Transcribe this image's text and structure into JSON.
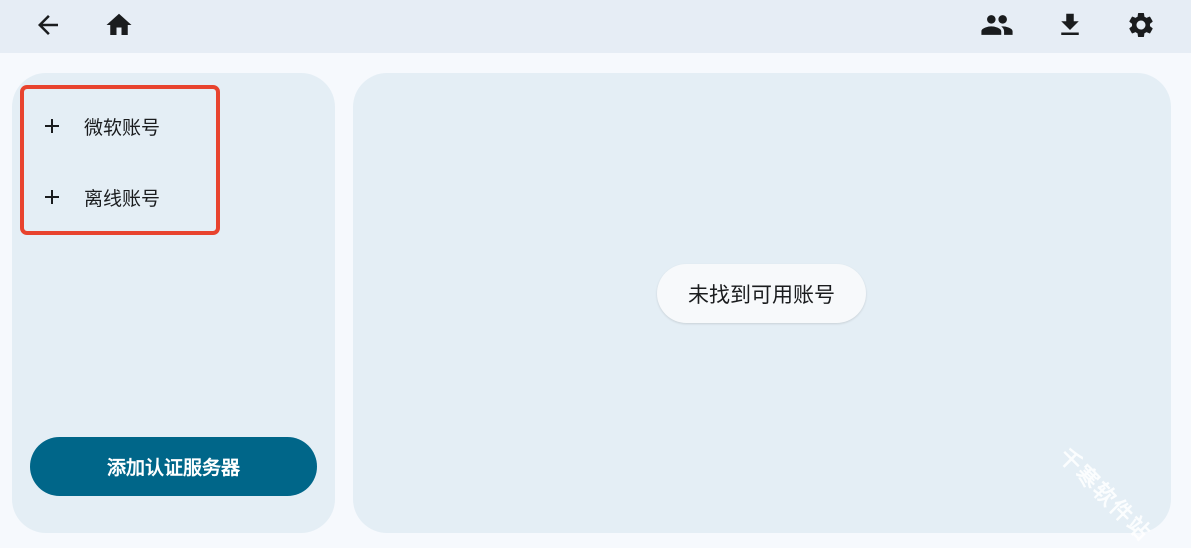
{
  "topbar": {
    "icons": {
      "back": "arrow-left-icon",
      "home": "home-icon",
      "accounts": "people-icon",
      "download": "download-icon",
      "settings": "gear-icon"
    }
  },
  "sidebar": {
    "items": [
      {
        "label": "微软账号",
        "icon": "plus-icon"
      },
      {
        "label": "离线账号",
        "icon": "plus-icon"
      }
    ],
    "add_server_label": "添加认证服务器"
  },
  "main": {
    "empty_message": "未找到可用账号"
  },
  "watermark": "千寒软件站",
  "colors": {
    "topbar_bg": "#e6edf5",
    "panel_bg": "#e4eef5",
    "primary": "#006689",
    "highlight": "#e8432e"
  }
}
